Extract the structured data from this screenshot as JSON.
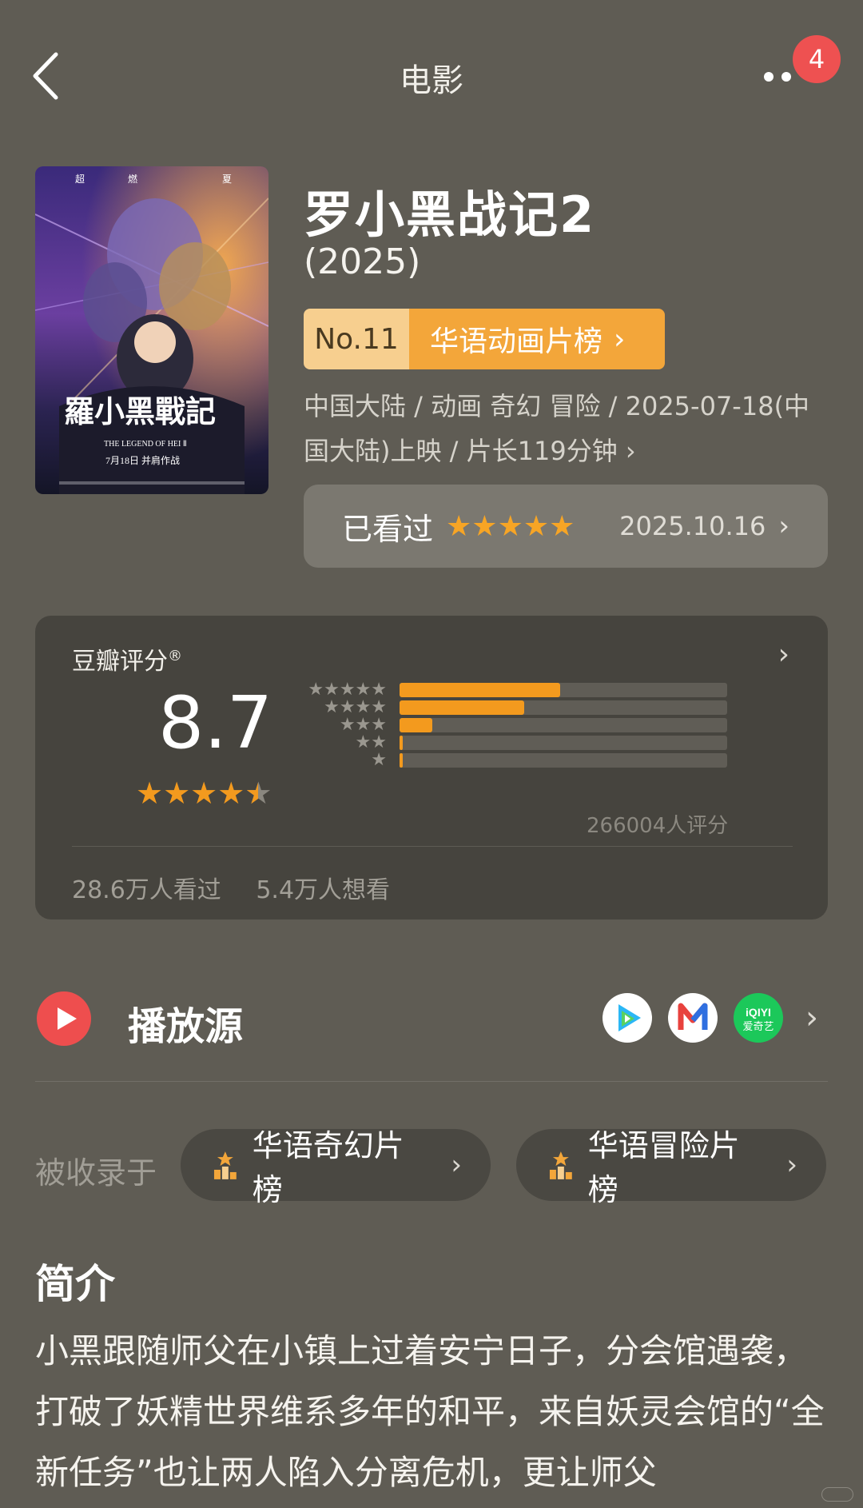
{
  "header": {
    "title": "电影",
    "badge_count": "4"
  },
  "movie": {
    "title": "罗小黑战记2",
    "year": "(2025)",
    "rank": {
      "no": "No.11",
      "name": "华语动画片榜"
    },
    "meta": "中国大陆 / 动画 奇幻 冒险 / 2025-07-18(中国大陆)上映 / 片长119分钟",
    "poster_text": {
      "top": [
        "超",
        "燃",
        "夏"
      ],
      "title_cn": "羅小黑戰記",
      "title_en": "THE LEGEND OF HEI Ⅱ",
      "release": "7月18日 并肩作战"
    }
  },
  "watched": {
    "label": "已看过",
    "stars": "★★★★★",
    "date": "2025.10.16"
  },
  "rating": {
    "label": "豆瓣评分",
    "score": "8.7",
    "stars": 4.5,
    "distribution": [
      {
        "stars": "★★★★★",
        "percent": 49
      },
      {
        "stars": "★★★★",
        "percent": 38
      },
      {
        "stars": "★★★",
        "percent": 10
      },
      {
        "stars": "★★",
        "percent": 1
      },
      {
        "stars": "★",
        "percent": 1
      }
    ],
    "count": "266004人评分",
    "watched_count": "28.6万人看过",
    "want_count": "5.4万人想看"
  },
  "play_source": {
    "title": "播放源",
    "apps": [
      {
        "name": "tencent-video-icon",
        "color": "#ffffff"
      },
      {
        "name": "mango-tv-icon",
        "color": "#ffffff",
        "letter": "M"
      },
      {
        "name": "iqiyi-icon",
        "color": "#1cc85a",
        "text": "iQIYI 爱奇艺"
      }
    ]
  },
  "included": {
    "label": "被收录于",
    "lists": [
      "华语奇幻片榜",
      "华语冒险片榜"
    ]
  },
  "intro": {
    "title": "简介",
    "text": "小黑跟随师父在小镇上过着安宁日子，分会馆遇袭，打破了妖精世界维系多年的和平，来自妖灵会馆的“全新任务”也让两人陷入分离危机，更让师父"
  },
  "colors": {
    "accent": "#f39a1e",
    "play": "#ee4e4e",
    "badge": "#ee5151"
  }
}
